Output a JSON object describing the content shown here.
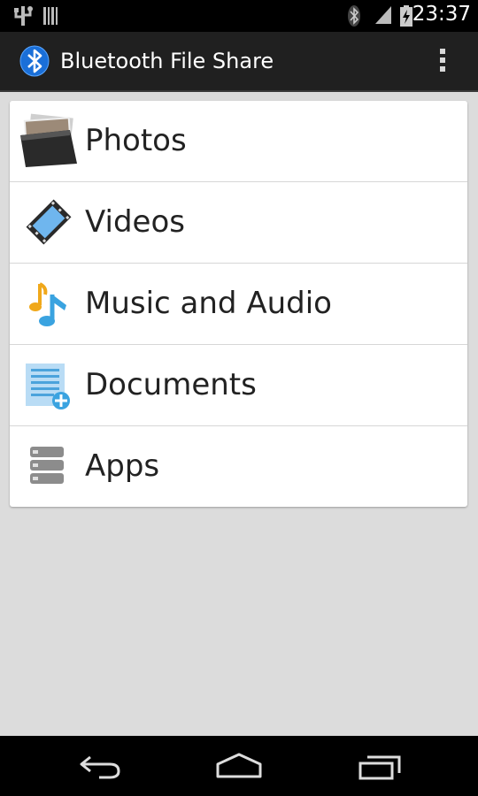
{
  "status_bar": {
    "time": "23:37",
    "icons": [
      "usb-icon",
      "barcode-icon",
      "bluetooth-icon",
      "signal-icon",
      "battery-charging-icon"
    ]
  },
  "action_bar": {
    "title": "Bluetooth File Share",
    "app_icon": "bluetooth-icon",
    "menu_icon": "overflow-menu-icon"
  },
  "menu": {
    "items": [
      {
        "label": "Photos",
        "icon": "photos-folder-icon"
      },
      {
        "label": "Videos",
        "icon": "film-icon"
      },
      {
        "label": "Music and Audio",
        "icon": "music-note-icon"
      },
      {
        "label": "Documents",
        "icon": "document-add-icon"
      },
      {
        "label": "Apps",
        "icon": "apps-stack-icon"
      }
    ]
  },
  "nav_bar": {
    "back_icon": "back-icon",
    "home_icon": "home-icon",
    "recents_icon": "recents-icon"
  },
  "colors": {
    "status_bar_bg": "#000000",
    "action_bar_bg": "#202020",
    "page_bg": "#dcdcdc",
    "card_bg": "#ffffff",
    "bluetooth_blue": "#1a6fd8"
  }
}
